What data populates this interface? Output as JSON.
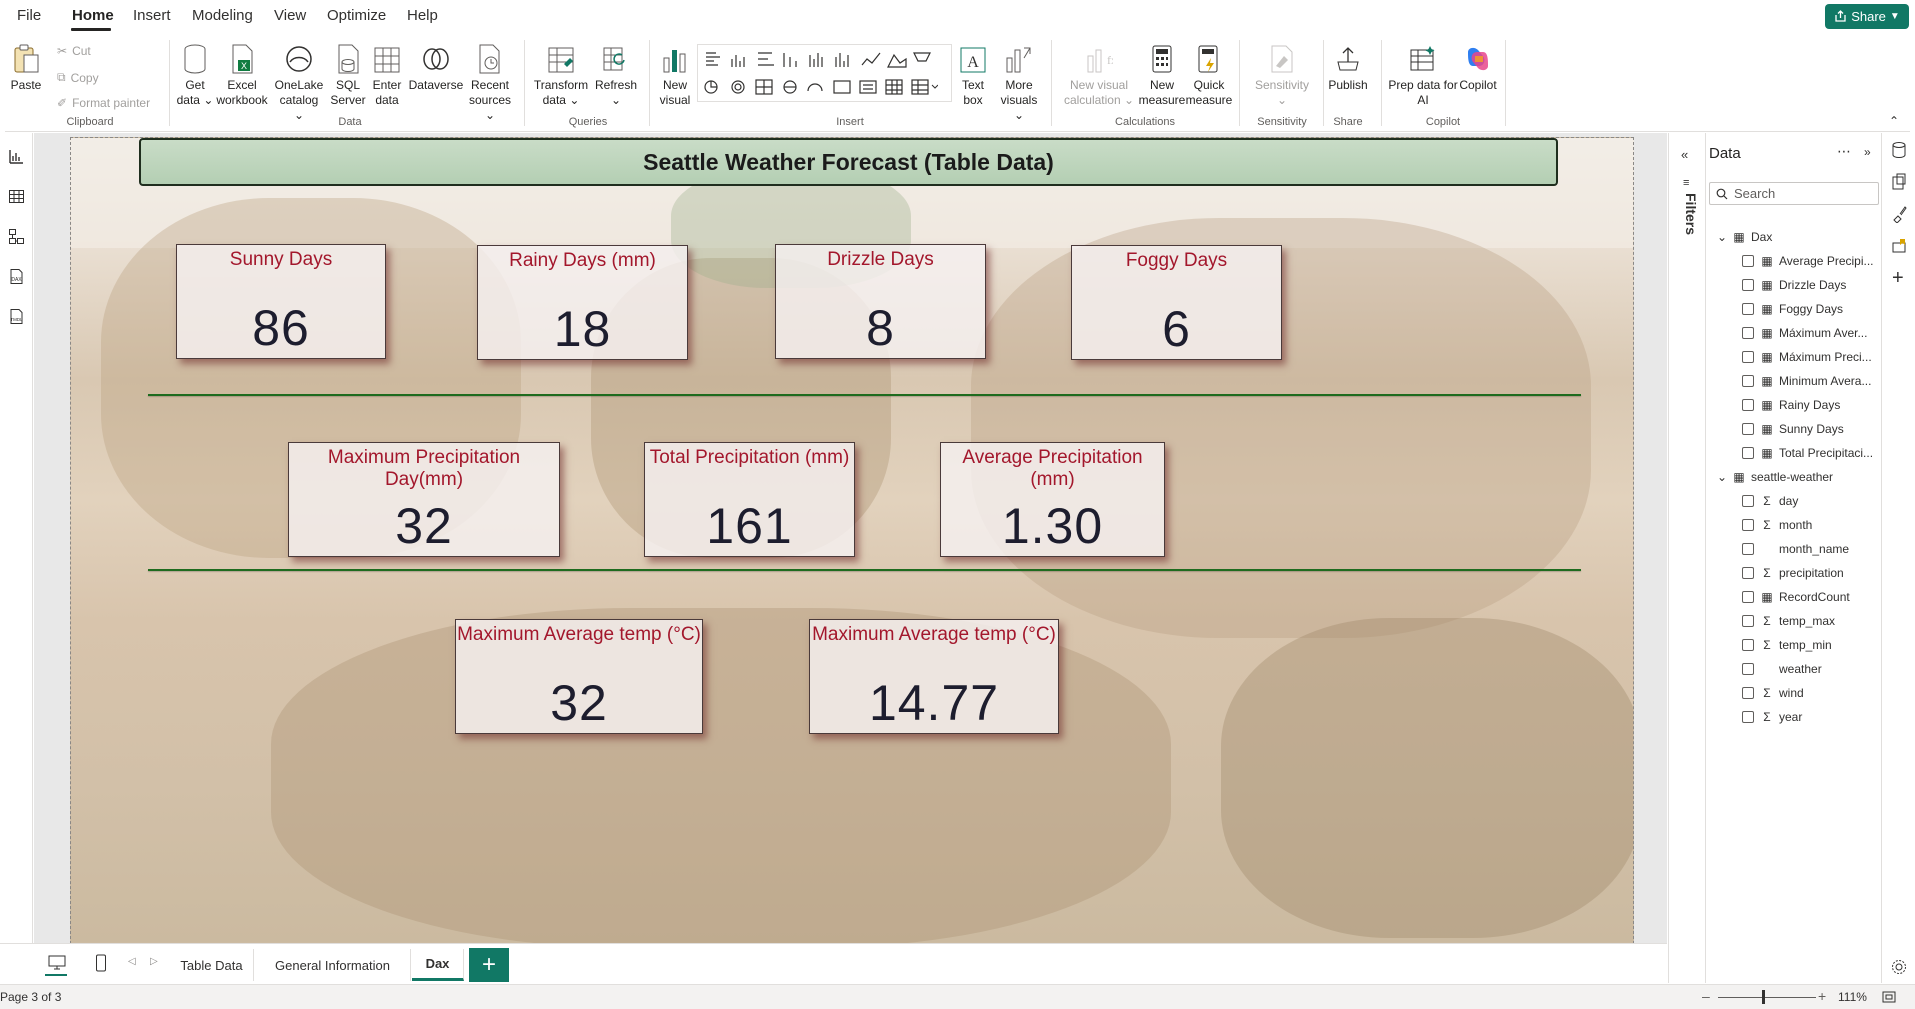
{
  "menu": {
    "items": [
      "File",
      "Home",
      "Insert",
      "Modeling",
      "View",
      "Optimize",
      "Help"
    ],
    "share_label": "Share"
  },
  "ribbon": {
    "clipboard": {
      "paste": "Paste",
      "cut": "Cut",
      "copy": "Copy",
      "format_painter": "Format painter",
      "group": "Clipboard"
    },
    "data": {
      "get_data": [
        "Get",
        "data"
      ],
      "excel": [
        "Excel",
        "workbook"
      ],
      "onelake": [
        "OneLake",
        "catalog"
      ],
      "sql": [
        "SQL",
        "Server"
      ],
      "enter": [
        "Enter",
        "data"
      ],
      "dataverse": "Dataverse",
      "recent": [
        "Recent",
        "sources"
      ],
      "group": "Data"
    },
    "queries": {
      "transform": [
        "Transform",
        "data"
      ],
      "refresh": "Refresh",
      "group": "Queries"
    },
    "insert": {
      "new_visual": [
        "New",
        "visual"
      ],
      "text_box": [
        "Text",
        "box"
      ],
      "more_visuals": [
        "More",
        "visuals"
      ],
      "group": "Insert"
    },
    "calculations": {
      "new_visual_calc": [
        "New visual",
        "calculation"
      ],
      "new_measure": [
        "New",
        "measure"
      ],
      "quick_measure": [
        "Quick",
        "measure"
      ],
      "group": "Calculations"
    },
    "sensitivity": {
      "label": "Sensitivity",
      "group": "Sensitivity"
    },
    "share": {
      "publish": "Publish",
      "group": "Share"
    },
    "copilot": {
      "prep": [
        "Prep data for",
        "AI"
      ],
      "copilot": "Copilot",
      "group": "Copilot"
    }
  },
  "report": {
    "title": "Seattle Weather Forecast (Table Data)",
    "cards": [
      {
        "label": "Sunny Days",
        "value": "86"
      },
      {
        "label": "Rainy Days (mm)",
        "value": "18"
      },
      {
        "label": "Drizzle Days",
        "value": "8"
      },
      {
        "label": "Foggy Days",
        "value": "6"
      },
      {
        "label": "Maximum Precipitation Day(mm)",
        "value": "32"
      },
      {
        "label": "Total Precipitation (mm)",
        "value": "161"
      },
      {
        "label": "Average Precipitation (mm)",
        "value": "1.30"
      },
      {
        "label": "Maximum Average temp (°C)",
        "value": "32"
      },
      {
        "label": "Maximum Average temp (°C)",
        "value": "14.77"
      }
    ]
  },
  "page_tabs": [
    "Table Data",
    "General Information",
    "Dax"
  ],
  "active_tab": "Dax",
  "status": {
    "page": "Page 3 of 3",
    "zoom": "111%"
  },
  "filters_label": "Filters",
  "data_pane": {
    "title": "Data",
    "search_placeholder": "Search",
    "tables": [
      {
        "name": "Dax",
        "fields": [
          {
            "name": "Average Precipi...",
            "icon": "calc"
          },
          {
            "name": "Drizzle Days",
            "icon": "calc"
          },
          {
            "name": "Foggy Days",
            "icon": "calc"
          },
          {
            "name": "Máximum Aver...",
            "icon": "calc"
          },
          {
            "name": "Máximum Preci...",
            "icon": "calc"
          },
          {
            "name": "Minimum Avera...",
            "icon": "calc"
          },
          {
            "name": "Rainy Days",
            "icon": "calc"
          },
          {
            "name": "Sunny Days",
            "icon": "calc"
          },
          {
            "name": "Total Precipitaci...",
            "icon": "calc"
          }
        ]
      },
      {
        "name": "seattle-weather",
        "fields": [
          {
            "name": "day",
            "icon": "sigma"
          },
          {
            "name": "month",
            "icon": "sigma"
          },
          {
            "name": "month_name",
            "icon": "none"
          },
          {
            "name": "precipitation",
            "icon": "sigma"
          },
          {
            "name": "RecordCount",
            "icon": "calc"
          },
          {
            "name": "temp_max",
            "icon": "sigma"
          },
          {
            "name": "temp_min",
            "icon": "sigma"
          },
          {
            "name": "weather",
            "icon": "none"
          },
          {
            "name": "wind",
            "icon": "sigma"
          },
          {
            "name": "year",
            "icon": "sigma"
          }
        ]
      }
    ]
  },
  "colors": {
    "accent": "#117865",
    "card_label": "#a3172c",
    "divider": "#1e6b1e"
  }
}
